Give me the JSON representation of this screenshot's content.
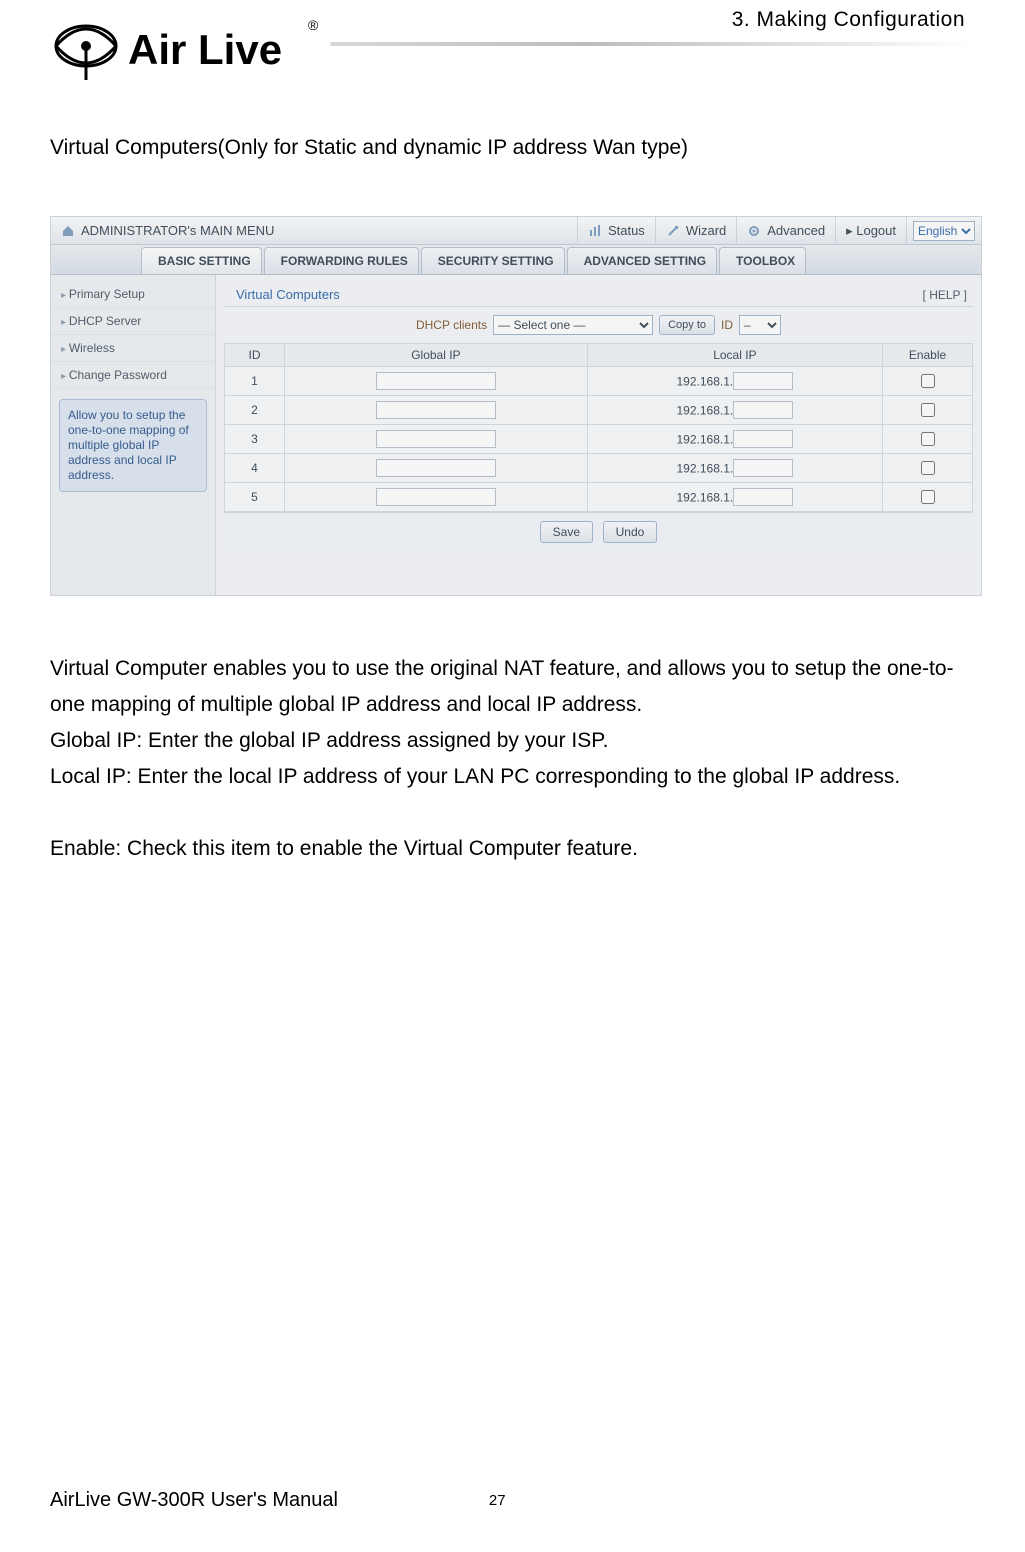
{
  "header": {
    "chapter": "3. Making Configuration",
    "logo_text": "Air Live",
    "logo_r": "®"
  },
  "section_title": "Virtual Computers(Only for Static and dynamic IP address Wan type)",
  "screenshot": {
    "topbar": {
      "menu_title": "ADMINISTRATOR's MAIN MENU",
      "status": "Status",
      "wizard": "Wizard",
      "advanced": "Advanced",
      "logout": "▸ Logout",
      "language": "English"
    },
    "tabs": {
      "basic": "BASIC SETTING",
      "forwarding": "FORWARDING RULES",
      "security": "SECURITY SETTING",
      "advanced": "ADVANCED SETTING",
      "toolbox": "TOOLBOX"
    },
    "sidebar": {
      "items": [
        "Primary Setup",
        "DHCP Server",
        "Wireless",
        "Change Password"
      ],
      "hint": "Allow you to setup the one-to-one mapping of multiple global IP address and local IP address."
    },
    "panel": {
      "title": "Virtual Computers",
      "help": "[ HELP ]",
      "dhcp_label": "DHCP clients",
      "dhcp_select": "— Select one —",
      "copyto": "Copy to",
      "id_label": "ID",
      "id_select": "–",
      "columns": {
        "id": "ID",
        "gip": "Global IP",
        "lip": "Local IP",
        "en": "Enable"
      },
      "local_prefix": "192.168.1.",
      "rows": [
        {
          "id": "1"
        },
        {
          "id": "2"
        },
        {
          "id": "3"
        },
        {
          "id": "4"
        },
        {
          "id": "5"
        }
      ],
      "save": "Save",
      "undo": "Undo"
    }
  },
  "paragraphs": {
    "p1": "Virtual Computer enables you to use the original NAT feature, and allows you to setup the one-to-one mapping of multiple global IP address and local IP address.",
    "p2": "Global IP: Enter the global IP address assigned by your ISP.",
    "p3": "Local IP: Enter the local IP address of your LAN PC corresponding to the global IP address.",
    "p4": "Enable: Check this item to enable the Virtual Computer feature."
  },
  "footer": {
    "manual": "AirLive GW-300R User's Manual",
    "page": "27"
  }
}
